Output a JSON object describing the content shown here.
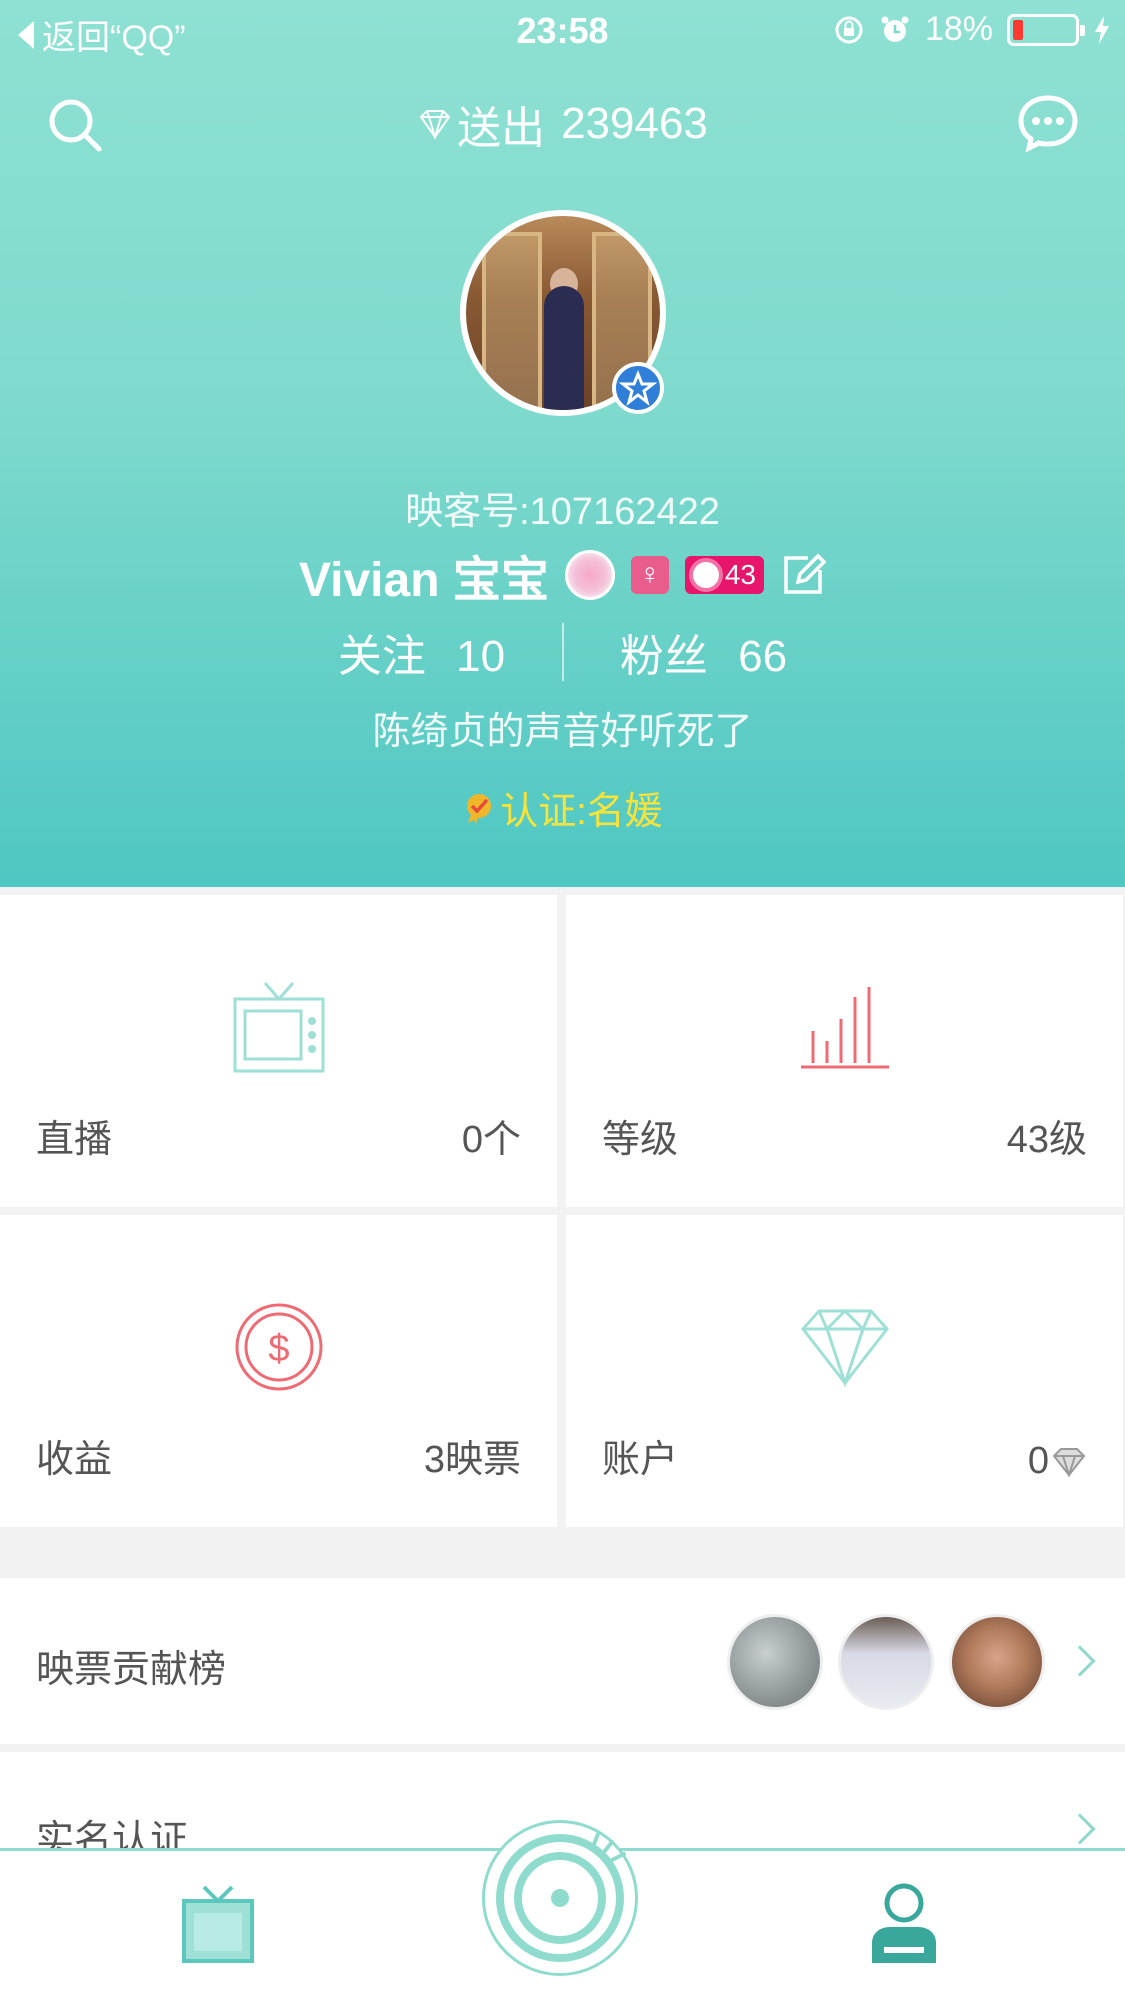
{
  "status_bar": {
    "back_label": "返回“QQ”",
    "time": "23:58",
    "battery": "18%"
  },
  "nav": {
    "sent_label": "送出",
    "sent_value": "239463"
  },
  "profile": {
    "yk_id": "映客号:107162422",
    "name": "Vivian 宝宝",
    "gender": "♀",
    "level_badge": "43",
    "following_label": "关注",
    "following_count": "10",
    "fans_label": "粉丝",
    "fans_count": "66",
    "bio": "陈绮贞的声音好听死了",
    "certification": "认证:名媛"
  },
  "tiles": [
    {
      "label": "直播",
      "value": "0个",
      "icon": "tv-icon"
    },
    {
      "label": "等级",
      "value": "43级",
      "icon": "bars-icon"
    },
    {
      "label": "收益",
      "value": "3映票",
      "icon": "dollar-icon"
    },
    {
      "label": "账户",
      "value": "0",
      "icon": "diamond-icon"
    }
  ],
  "list": {
    "contribution_label": "映票贡献榜",
    "realname_label": "实名认证"
  },
  "colors": {
    "header_top": "#8ee1d3",
    "header_bottom": "#4fc7c2",
    "accent_teal": "#8fdccf",
    "tv_icon": "#9fe0d6",
    "bars_icon": "#ef6b73",
    "dollar_icon": "#ef6b73",
    "cert_text": "#f6e33b",
    "level_badge": "#e8156c"
  }
}
